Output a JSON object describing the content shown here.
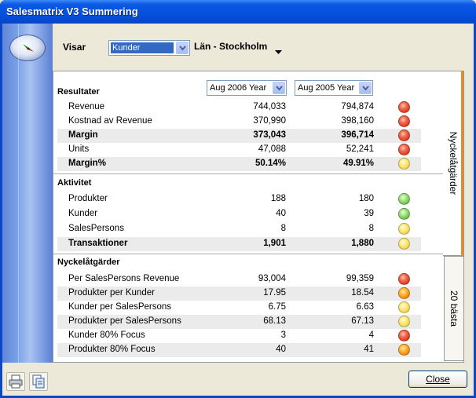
{
  "window": {
    "title": "Salesmatrix V3 Summering"
  },
  "toolbar": {
    "visar_label": "Visar",
    "view_select": "Kunder",
    "region": "Län - Stockholm"
  },
  "columns": {
    "year1": "Aug 2006 Year",
    "year2": "Aug 2005 Year"
  },
  "sections": [
    {
      "title": "Resultater",
      "rows": [
        {
          "label": "Revenue",
          "v1": "744,033",
          "v2": "794,874",
          "status": "red",
          "bold": false,
          "shade": false
        },
        {
          "label": "Kostnad av Revenue",
          "v1": "370,990",
          "v2": "398,160",
          "status": "red",
          "bold": false,
          "shade": false
        },
        {
          "label": "Margin",
          "v1": "373,043",
          "v2": "396,714",
          "status": "red",
          "bold": true,
          "shade": true
        },
        {
          "label": "Units",
          "v1": "47,088",
          "v2": "52,241",
          "status": "red",
          "bold": false,
          "shade": false
        },
        {
          "label": "Margin%",
          "v1": "50.14%",
          "v2": "49.91%",
          "status": "yellow",
          "bold": true,
          "shade": true
        }
      ]
    },
    {
      "title": "Aktivitet",
      "rows": [
        {
          "label": "Produkter",
          "v1": "188",
          "v2": "180",
          "status": "green",
          "bold": false,
          "shade": false
        },
        {
          "label": "Kunder",
          "v1": "40",
          "v2": "39",
          "status": "green",
          "bold": false,
          "shade": false
        },
        {
          "label": "SalesPersons",
          "v1": "8",
          "v2": "8",
          "status": "yellow",
          "bold": false,
          "shade": false
        },
        {
          "label": "Transaktioner",
          "v1": "1,901",
          "v2": "1,880",
          "status": "yellow",
          "bold": true,
          "shade": true
        }
      ]
    },
    {
      "title": "Nyckelåtgärder",
      "rows": [
        {
          "label": "Per SalesPersons Revenue",
          "v1": "93,004",
          "v2": "99,359",
          "status": "red",
          "bold": false,
          "shade": false
        },
        {
          "label": "Produkter per Kunder",
          "v1": "17.95",
          "v2": "18.54",
          "status": "orange",
          "bold": false,
          "shade": true
        },
        {
          "label": "Kunder per SalesPersons",
          "v1": "6.75",
          "v2": "6.63",
          "status": "yellow",
          "bold": false,
          "shade": false
        },
        {
          "label": "Produkter per SalesPersons",
          "v1": "68.13",
          "v2": "67.13",
          "status": "yellow",
          "bold": false,
          "shade": true
        },
        {
          "label": "Kunder 80% Focus",
          "v1": "3",
          "v2": "4",
          "status": "red",
          "bold": false,
          "shade": false
        },
        {
          "label": "Produkter 80% Focus",
          "v1": "40",
          "v2": "41",
          "status": "orange",
          "bold": false,
          "shade": true
        }
      ]
    }
  ],
  "tabs": [
    {
      "label": "Nyckelåtgärder",
      "active": true
    },
    {
      "label": "20 bästa",
      "active": false
    }
  ],
  "footer": {
    "close_label": "Close"
  },
  "colors": {
    "title_bar": "#0550dd",
    "accent_tab": "#e68b2c",
    "selection": "#316ac5"
  }
}
